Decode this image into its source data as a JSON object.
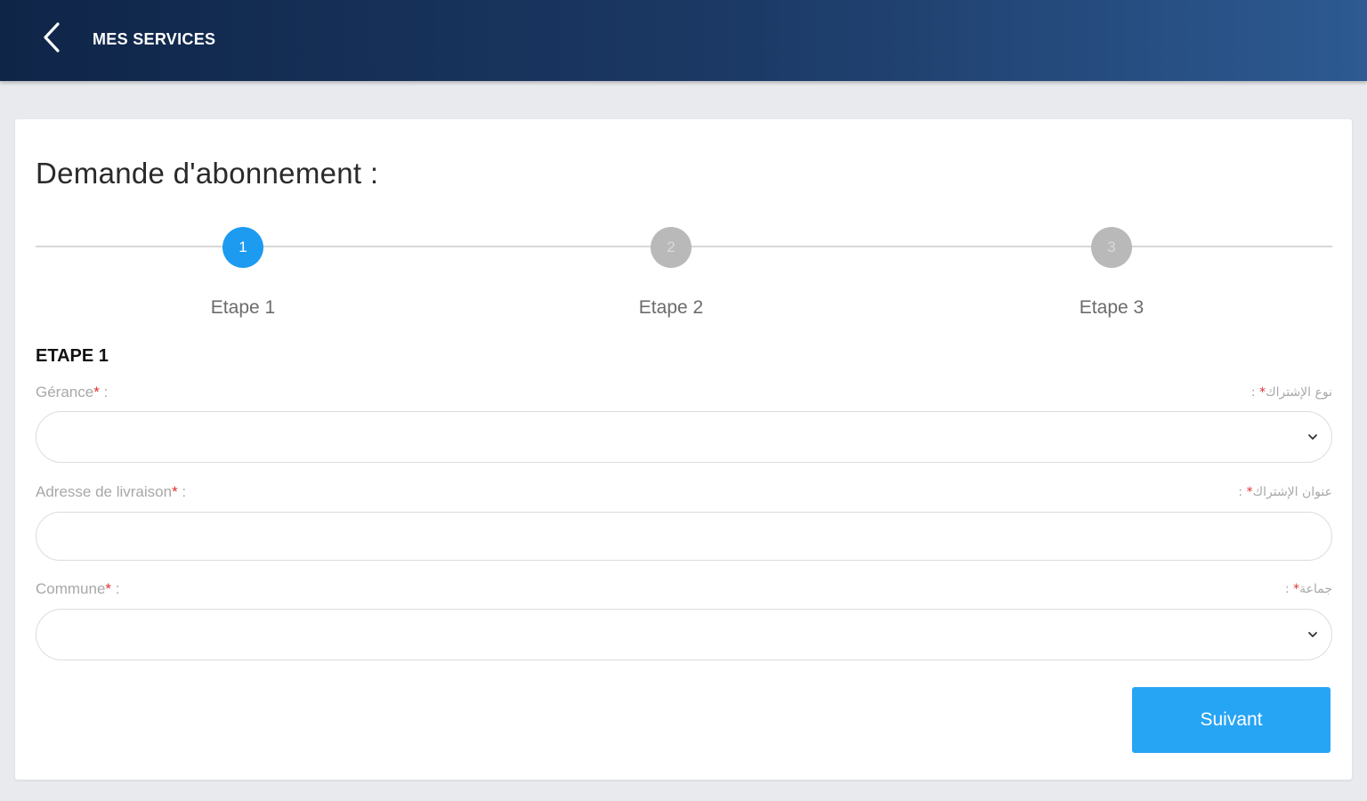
{
  "header": {
    "back_icon": "chevron-left-icon",
    "title": "MES SERVICES",
    "colors": {
      "gradient_start": "#0f2548",
      "gradient_end": "#2d5a92"
    }
  },
  "form": {
    "title": "Demande d'abonnement :",
    "steps": [
      {
        "number": "1",
        "label": "Etape 1",
        "state": "active"
      },
      {
        "number": "2",
        "label": "Etape 2",
        "state": "inactive"
      },
      {
        "number": "3",
        "label": "Etape 3",
        "state": "inactive"
      }
    ],
    "section_title": "ETAPE 1",
    "fields": [
      {
        "label": "Gérance",
        "required_mark": "*",
        "suffix": " :",
        "label_ar": "نوع الإشتراك",
        "label_ar_suffix": " :",
        "type": "select",
        "value": ""
      },
      {
        "label": "Adresse de livraison",
        "required_mark": "*",
        "suffix": " :",
        "label_ar": "عنوان الإشتراك",
        "label_ar_suffix": " :",
        "type": "text",
        "value": ""
      },
      {
        "label": "Commune",
        "required_mark": "*",
        "suffix": " :",
        "label_ar": "جماعة",
        "label_ar_suffix": " :",
        "type": "select",
        "value": ""
      }
    ],
    "next_button": "Suivant",
    "colors": {
      "accent": "#1d9bf0",
      "button": "#27a5f5",
      "required": "#e03030"
    }
  }
}
